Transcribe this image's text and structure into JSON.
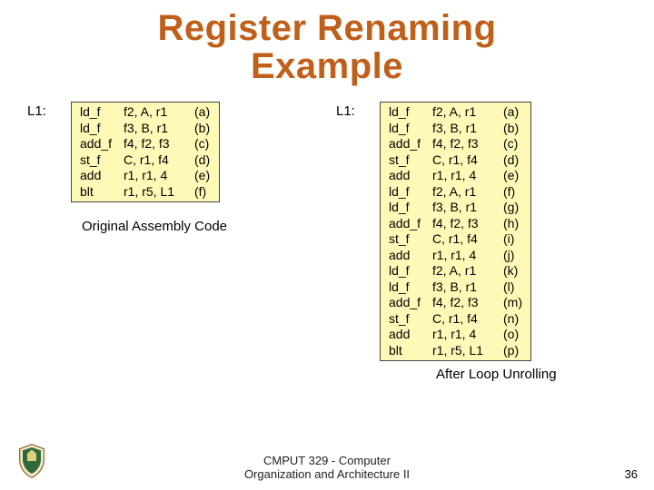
{
  "title_line1": "Register Renaming",
  "title_line2": "Example",
  "left": {
    "label": "L1:",
    "caption": "Original Assembly Code",
    "rows": [
      {
        "op": "ld_f",
        "args": "f2, A, r1",
        "tag": "(a)"
      },
      {
        "op": "ld_f",
        "args": "f3, B, r1",
        "tag": "(b)"
      },
      {
        "op": "add_f",
        "args": "f4, f2, f3",
        "tag": "(c)"
      },
      {
        "op": "st_f",
        "args": "C, r1, f4",
        "tag": "(d)"
      },
      {
        "op": "add",
        "args": "r1, r1, 4",
        "tag": "(e)"
      },
      {
        "op": "blt",
        "args": "r1, r5, L1",
        "tag": "(f)"
      }
    ]
  },
  "right": {
    "label": "L1:",
    "caption": "After Loop Unrolling",
    "rows": [
      {
        "op": "ld_f",
        "args": "f2, A, r1",
        "tag": "(a)"
      },
      {
        "op": "ld_f",
        "args": "f3, B, r1",
        "tag": "(b)"
      },
      {
        "op": "add_f",
        "args": "f4, f2, f3",
        "tag": "(c)"
      },
      {
        "op": "st_f",
        "args": "C, r1, f4",
        "tag": "(d)"
      },
      {
        "op": "add",
        "args": "r1, r1, 4",
        "tag": "(e)"
      },
      {
        "op": "ld_f",
        "args": "f2, A, r1",
        "tag": "(f)"
      },
      {
        "op": "ld_f",
        "args": "f3, B, r1",
        "tag": "(g)"
      },
      {
        "op": "add_f",
        "args": "f4, f2, f3",
        "tag": "(h)"
      },
      {
        "op": "st_f",
        "args": "C, r1, f4",
        "tag": "(i)"
      },
      {
        "op": "add",
        "args": "r1, r1, 4",
        "tag": "(j)"
      },
      {
        "op": "ld_f",
        "args": "f2, A, r1",
        "tag": "(k)"
      },
      {
        "op": "ld_f",
        "args": "f3, B, r1",
        "tag": "(l)"
      },
      {
        "op": "add_f",
        "args": "f4, f2, f3",
        "tag": "(m)"
      },
      {
        "op": "st_f",
        "args": "C, r1, f4",
        "tag": "(n)"
      },
      {
        "op": "add",
        "args": "r1, r1, 4",
        "tag": "(o)"
      },
      {
        "op": "blt",
        "args": "r1, r5, L1",
        "tag": "(p)"
      }
    ]
  },
  "footer_line1": "CMPUT 329 - Computer",
  "footer_line2": "Organization and Architecture II",
  "page_number": "36"
}
